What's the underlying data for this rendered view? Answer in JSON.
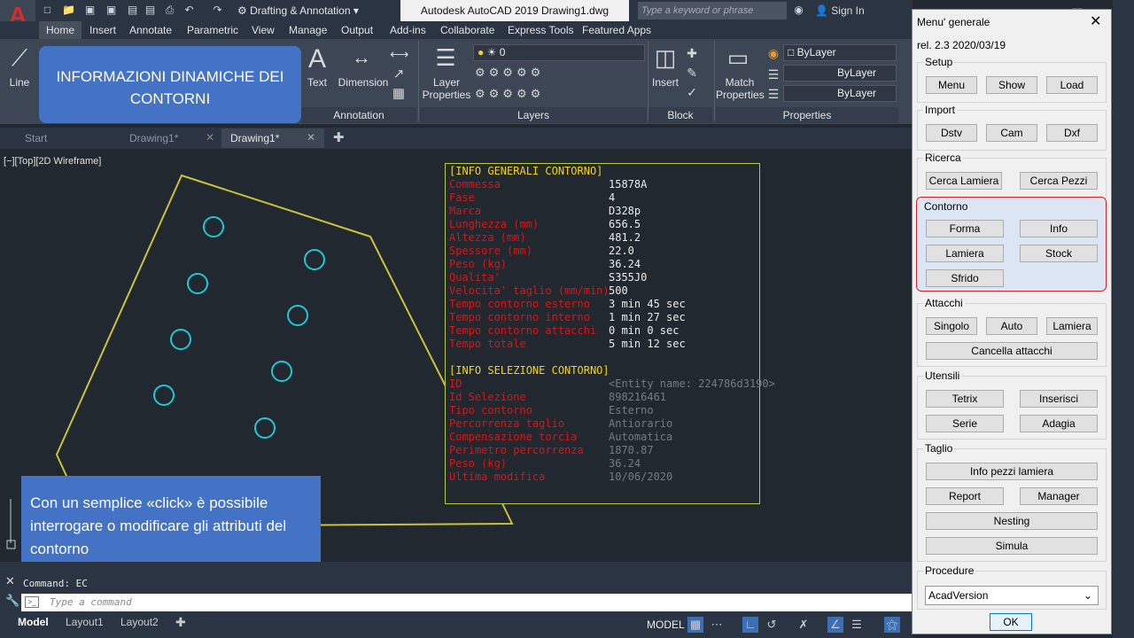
{
  "app": {
    "workspace": "Drafting & Annotation",
    "doc_title": "Autodesk AutoCAD 2019   Drawing1.dwg",
    "search_placeholder": "Type a keyword or phrase",
    "signin": "Sign In"
  },
  "ribbon_tabs": [
    "Home",
    "Insert",
    "Annotate",
    "Parametric",
    "View",
    "Manage",
    "Output",
    "Add-ins",
    "Collaborate",
    "Express Tools",
    "Featured Apps"
  ],
  "ribbon": {
    "line_label": "Line",
    "text_label": "Text",
    "dimension_label": "Dimension",
    "annotation_title": "Annotation",
    "layer_properties_label": "Layer Properties",
    "layer_value": "0",
    "layers_title": "Layers",
    "insert_label": "Insert",
    "block_title": "Block",
    "match_properties_label": "Match Properties",
    "bylayer_color": "ByLayer",
    "bylayer_linetype": "ByLayer",
    "bylayer_lineweight": "ByLayer",
    "properties_title": "Properties"
  },
  "doc_tabs": [
    "Start",
    "Drawing1*",
    "Drawing1*"
  ],
  "viewport_label": "[−][Top][2D Wireframe]",
  "info_panel": {
    "general_header": "[INFO GENERALI CONTORNO]",
    "general_rows": [
      {
        "key": "Commessa",
        "value": "15878A"
      },
      {
        "key": "Fase",
        "value": "4"
      },
      {
        "key": "Marca",
        "value": "D328p"
      },
      {
        "key": "Lunghezza (mm)",
        "value": "656.5"
      },
      {
        "key": "Altezza (mm)",
        "value": "481.2"
      },
      {
        "key": "Spessore (mm)",
        "value": "22.0"
      },
      {
        "key": "Peso (kg)",
        "value": "36.24"
      },
      {
        "key": "Qualita'",
        "value": "S355J0"
      },
      {
        "key": "Velocita' taglio (mm/min)",
        "value": "500"
      },
      {
        "key": "Tempo contorno esterno",
        "value": "3 min 45 sec"
      },
      {
        "key": "Tempo contorno interno",
        "value": "1 min 27 sec"
      },
      {
        "key": "Tempo contorno attacchi",
        "value": "0 min 0 sec"
      },
      {
        "key": "Tempo totale",
        "value": "5 min 12 sec"
      }
    ],
    "selection_header": "[INFO SELEZIONE CONTORNO]",
    "selection_rows": [
      {
        "key": "ID",
        "value": "<Entity name: 224786d3190>"
      },
      {
        "key": "Id Selezione",
        "value": "898216461"
      },
      {
        "key": "Tipo contorno",
        "value": "Esterno"
      },
      {
        "key": "Percorrenza taglio",
        "value": "Antiorario"
      },
      {
        "key": "Compensazione torcia",
        "value": "Automatica"
      },
      {
        "key": "Perimetro percorrenza",
        "value": "1870.87"
      },
      {
        "key": "Peso (kg)",
        "value": "36.24"
      },
      {
        "key": "Ultima modifica",
        "value": "10/06/2020"
      }
    ]
  },
  "callouts": {
    "title": "INFORMAZIONI DINAMICHE DEI CONTORNI",
    "description": "Con un semplice «click» è possibile interrogare o modificare gli attributi del contorno"
  },
  "command": {
    "history": "Command: EC",
    "placeholder": "Type a command"
  },
  "layout_tabs": [
    "Model",
    "Layout1",
    "Layout2"
  ],
  "status": {
    "model": "MODEL"
  },
  "dialog": {
    "title": "Menu' generale",
    "release": "rel. 2.3 2020/03/19",
    "setup": {
      "label": "Setup",
      "buttons": [
        "Menu",
        "Show",
        "Load"
      ]
    },
    "import": {
      "label": "Import",
      "buttons": [
        "Dstv",
        "Cam",
        "Dxf"
      ]
    },
    "ricerca": {
      "label": "Ricerca",
      "buttons": [
        "Cerca Lamiera",
        "Cerca Pezzi"
      ]
    },
    "contorno": {
      "label": "Contorno",
      "buttons": [
        "Forma",
        "Info",
        "Lamiera",
        "Stock",
        "Sfrido"
      ]
    },
    "attacchi": {
      "label": "Attacchi",
      "buttons": [
        "Singolo",
        "Auto",
        "Lamiera",
        "Cancella attacchi"
      ]
    },
    "utensili": {
      "label": "Utensili",
      "buttons": [
        "Tetrix",
        "Inserisci",
        "Serie",
        "Adagia"
      ]
    },
    "taglio": {
      "label": "Taglio",
      "buttons": [
        "Info pezzi lamiera",
        "Report",
        "Manager",
        "Nesting",
        "Simula"
      ]
    },
    "procedure": {
      "label": "Procedure",
      "selected": "AcadVersion"
    },
    "ok": "OK"
  },
  "colors": {
    "accent": "#4472c4",
    "contour_line": "#c9c23a",
    "holes": "#22c7d6",
    "info_key": "#d91515",
    "info_header": "#f3d21c",
    "highlight_border": "#d0232b"
  }
}
